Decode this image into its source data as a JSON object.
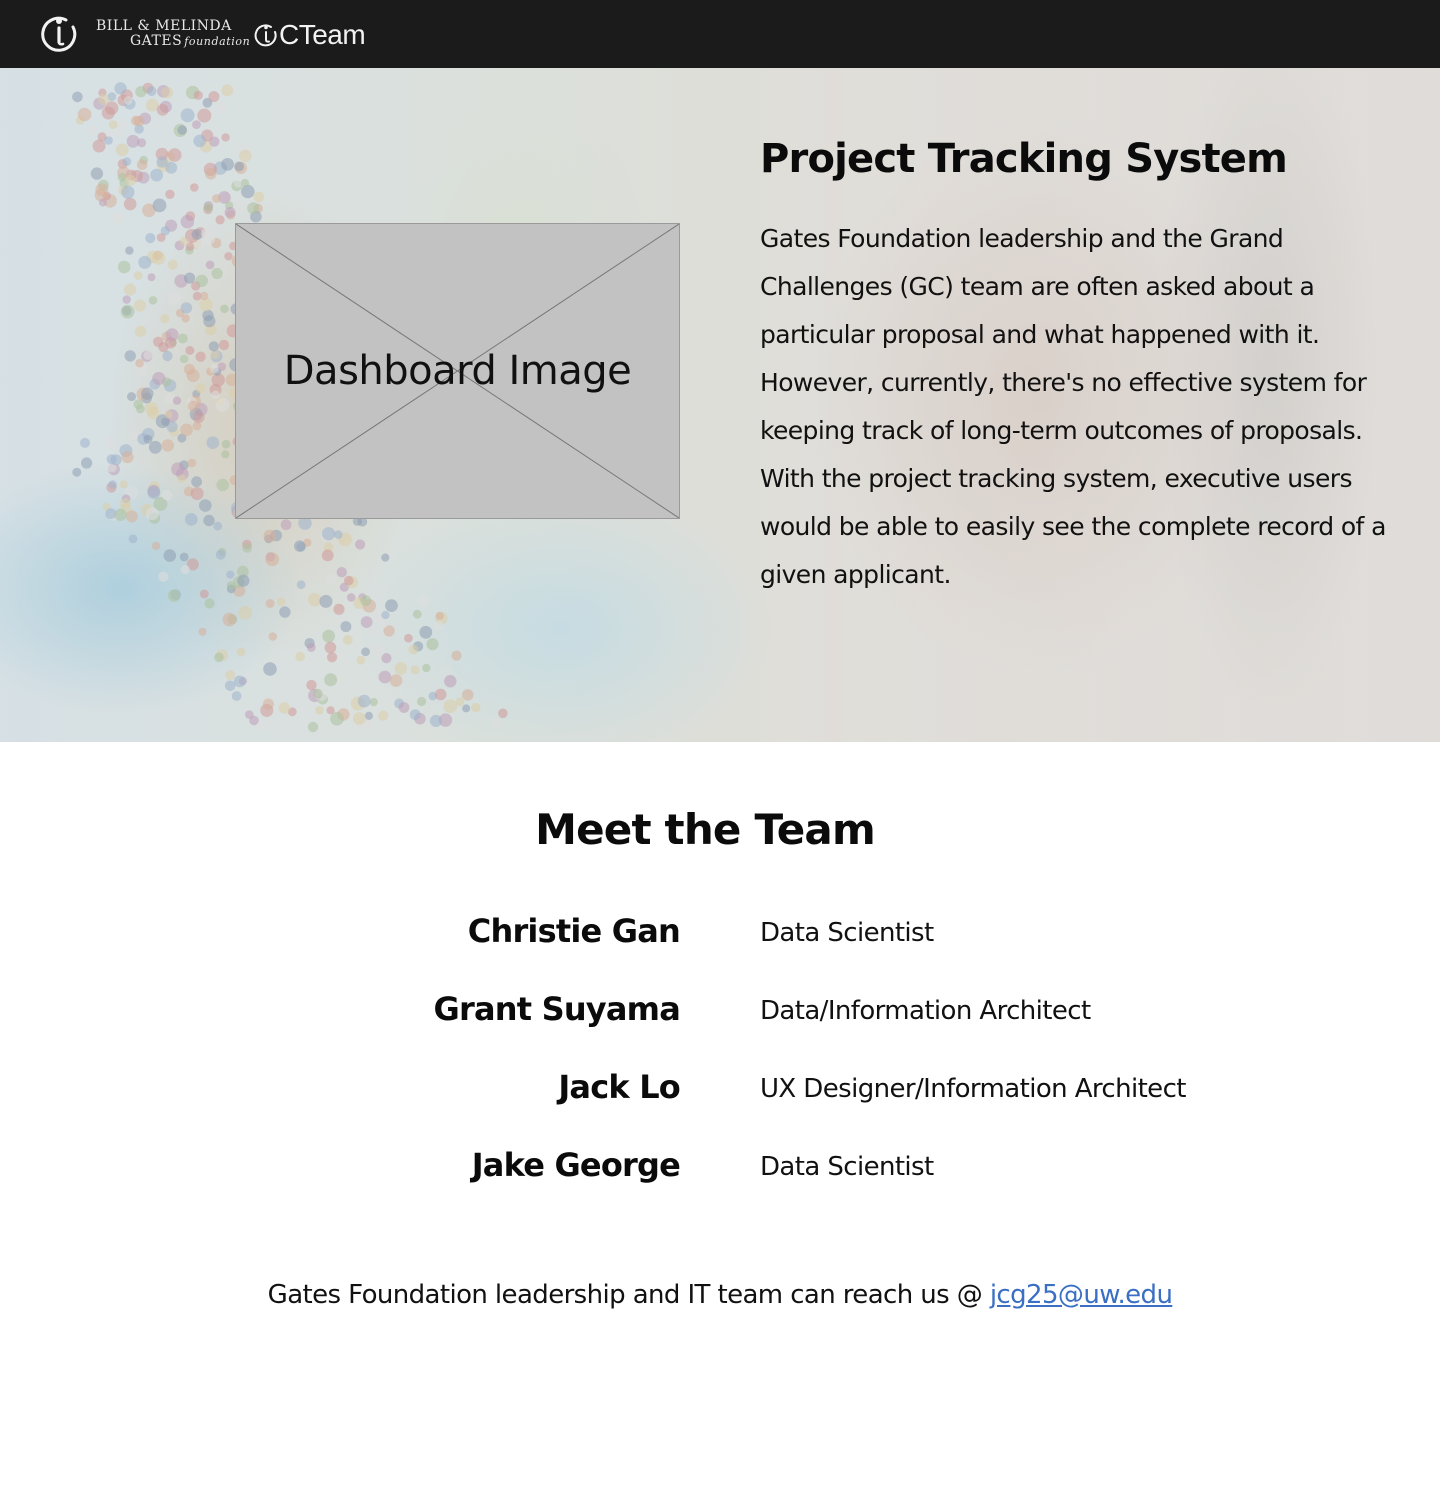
{
  "header": {
    "foundation_logo_line1": "BILL & MELINDA",
    "foundation_logo_line2": "GATES",
    "foundation_logo_line2_italic": "foundation",
    "team_logo_text": "CTeam"
  },
  "hero": {
    "image_label": "Dashboard Image",
    "title": "Project Tracking System",
    "description": "Gates Foundation leadership and the Grand Challenges (GC) team are often asked about a particular proposal and what happened with it. However, currently, there's no effective system for keeping track of long-term outcomes of proposals. With the project tracking system, executive users would be able to easily see the complete record of a given applicant."
  },
  "team": {
    "title": "Meet the Team",
    "members": [
      {
        "name": "Christie Gan",
        "role": "Data Scientist"
      },
      {
        "name": "Grant Suyama",
        "role": "Data/Information Architect"
      },
      {
        "name": "Jack Lo",
        "role": "UX Designer/Information Architect"
      },
      {
        "name": "Jake George",
        "role": "Data Scientist"
      }
    ]
  },
  "contact": {
    "text": "Gates Foundation leadership and IT team can reach us @ ",
    "email": "jcg25@uw.edu"
  },
  "colors": {
    "topbar_bg": "#1b1b1b",
    "link": "#3a6fc4",
    "placeholder_bg": "#c2c2c2"
  }
}
